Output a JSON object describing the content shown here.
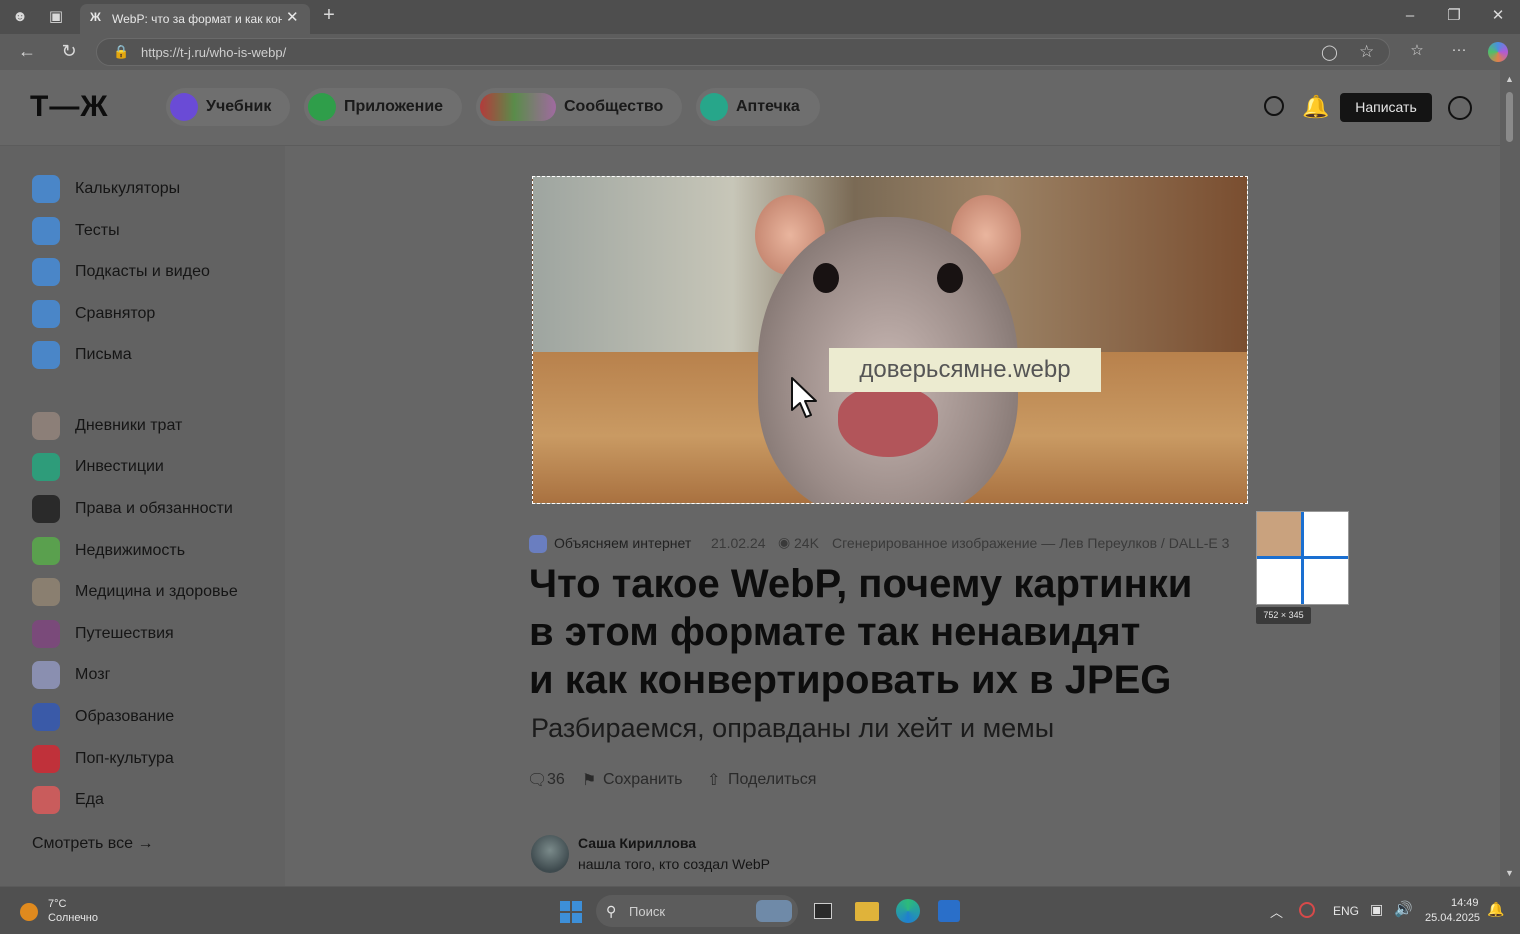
{
  "browser": {
    "tab_title": "WebP: что за формат и как конв",
    "url": "https://t-j.ru/who-is-webp/"
  },
  "header": {
    "logo": "Т—Ж",
    "nav": [
      {
        "label": "Учебник",
        "color": "#6a4bd6"
      },
      {
        "label": "Приложение",
        "color": "#2f9e4a"
      },
      {
        "label": "Сообщество",
        "color": "#b94a5a"
      },
      {
        "label": "Аптечка",
        "color": "#27a68a"
      }
    ],
    "write_button": "Написать"
  },
  "sidebar": {
    "items_top": [
      "Калькуляторы",
      "Тесты",
      "Подкасты и видео",
      "Сравнятор",
      "Письма"
    ],
    "items_bottom": [
      "Дневники трат",
      "Инвестиции",
      "Права и обязанности",
      "Недвижимость",
      "Медицина и здоровье",
      "Путешествия",
      "Мозг",
      "Образование",
      "Поп-культура",
      "Еда"
    ],
    "see_all": "Смотреть все →"
  },
  "article": {
    "image_caption_label": "доверьсямне.webp",
    "category": "Объясняем интернет",
    "date": "21.02.24",
    "views": "24K",
    "image_credit": "Сгенерированное изображение — Лев Переулков / DALL-E 3",
    "title_lines": [
      "Что такое WebP, почему картинки",
      "в этом формате так ненавидят",
      "и как конвертировать их в JPEG"
    ],
    "subtitle": "Разбираемся, оправданы ли хейт и мемы",
    "comments_count": "36",
    "save_label": "Сохранить",
    "share_label": "Поделиться",
    "author_name": "Саша Кириллова",
    "author_note": "нашла того, кто создал WebP"
  },
  "capture_overlay": {
    "size_label": "752 × 345"
  },
  "taskbar": {
    "weather_temp": "7°C",
    "weather_text": "Солнечно",
    "search_placeholder": "Поиск",
    "lang": "ENG",
    "time": "14:49",
    "date": "25.04.2025"
  }
}
